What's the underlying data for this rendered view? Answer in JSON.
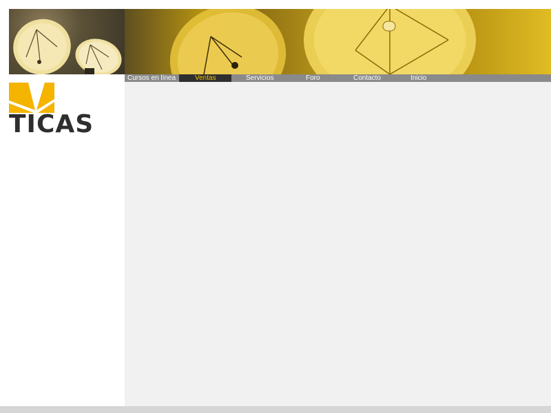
{
  "site": {
    "logo_text": "TICAS"
  },
  "nav": {
    "items": [
      {
        "label": "Cursos en línea"
      },
      {
        "label": "Ventas"
      },
      {
        "label": "Servicios"
      },
      {
        "label": "Foro"
      },
      {
        "label": "Contacto"
      },
      {
        "label": "Inicio"
      }
    ],
    "active_index": 1
  },
  "colors": {
    "accent": "#f2c200",
    "nav_bg": "#8a8a8a",
    "nav_active_bg": "#2f2f2f",
    "content_bg": "#f1f1f1",
    "logo_dark": "#2e2e2e"
  },
  "icons": {
    "banner": "satellite-dishes-photo",
    "logo": "ticas-logo"
  }
}
